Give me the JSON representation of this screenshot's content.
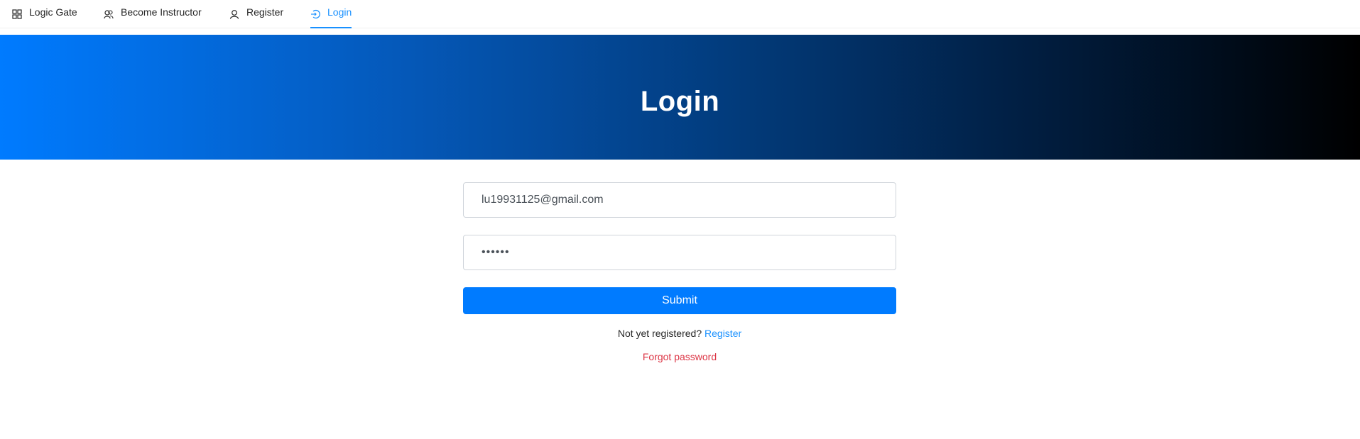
{
  "nav": {
    "items": [
      {
        "label": "Logic Gate",
        "icon": "app-grid-icon",
        "active": false
      },
      {
        "label": "Become Instructor",
        "icon": "team-icon",
        "active": false
      },
      {
        "label": "Register",
        "icon": "user-icon",
        "active": false
      },
      {
        "label": "Login",
        "icon": "login-icon",
        "active": true
      }
    ]
  },
  "hero": {
    "title": "Login",
    "gradient": [
      "#007bff",
      "#000000"
    ]
  },
  "form": {
    "email_value": "lu19931125@gmail.com",
    "password_masked": "••••••",
    "submit_label": "Submit",
    "not_registered_text": "Not yet registered?",
    "register_link": "Register",
    "forgot_password": "Forgot password"
  },
  "colors": {
    "primary": "#007bff",
    "link": "#1890ff",
    "danger": "#dc3545"
  }
}
